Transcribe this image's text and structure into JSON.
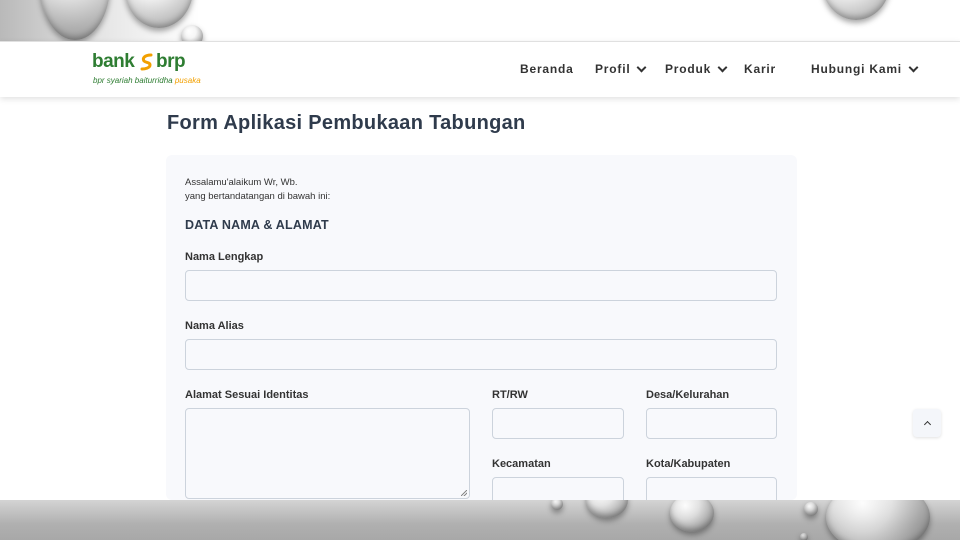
{
  "brand": {
    "word_left": "bank",
    "word_right": "brp",
    "tagline_main": "bpr syariah baiturridha",
    "tagline_accent": "pusaka",
    "colors": {
      "green": "#2e7d32",
      "orange": "#f2a000"
    }
  },
  "nav": {
    "items": [
      {
        "label": "Beranda",
        "dropdown": false
      },
      {
        "label": "Profil",
        "dropdown": true
      },
      {
        "label": "Produk",
        "dropdown": true
      },
      {
        "label": "Karir",
        "dropdown": false
      },
      {
        "label": "Hubungi Kami",
        "dropdown": true
      }
    ]
  },
  "page": {
    "title": "Form Aplikasi Pembukaan Tabungan"
  },
  "form": {
    "greeting_line1": "Assalamu'alaikum Wr, Wb.",
    "greeting_line2": "yang bertandatangan di bawah ini:",
    "section_title": "DATA NAMA & ALAMAT",
    "fields": {
      "full_name": {
        "label": "Nama Lengkap",
        "value": ""
      },
      "alias": {
        "label": "Nama Alias",
        "value": ""
      },
      "address": {
        "label": "Alamat Sesuai Identitas",
        "value": ""
      },
      "rt_rw": {
        "label": "RT/RW",
        "value": ""
      },
      "village": {
        "label": "Desa/Kelurahan",
        "value": ""
      },
      "district": {
        "label": "Kecamatan",
        "value": ""
      },
      "city": {
        "label": "Kota/Kabupaten",
        "value": ""
      }
    }
  },
  "icons": {
    "back_to_top": "chevron-up-icon",
    "nav_dropdown": "chevron-down-icon"
  }
}
